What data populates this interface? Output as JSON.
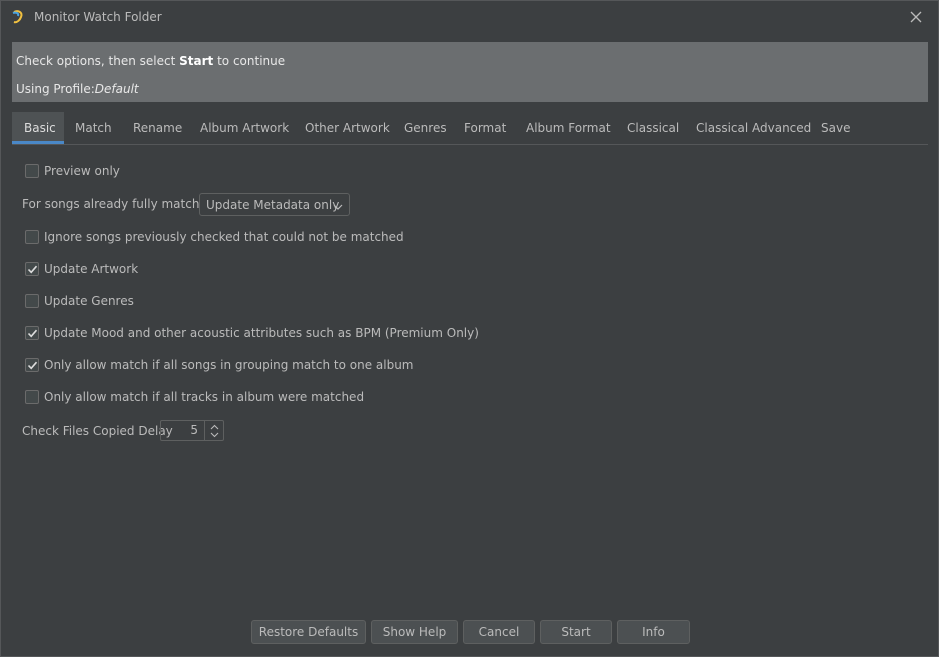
{
  "window": {
    "title": "Monitor Watch Folder"
  },
  "info": {
    "line1_prefix": "Check options, then select ",
    "line1_bold": "Start",
    "line1_suffix": " to continue",
    "profile_label": "Using Profile:",
    "profile_value": "Default"
  },
  "tabs": [
    {
      "label": "Basic",
      "active": true
    },
    {
      "label": "Match"
    },
    {
      "label": "Rename"
    },
    {
      "label": "Album Artwork"
    },
    {
      "label": "Other Artwork"
    },
    {
      "label": "Genres"
    },
    {
      "label": "Format"
    },
    {
      "label": "Album Format"
    },
    {
      "label": "Classical"
    },
    {
      "label": "Classical Advanced"
    },
    {
      "label": "Save"
    }
  ],
  "options": {
    "preview_only": {
      "label": "Preview only",
      "checked": false
    },
    "fully_matched_label": "For songs already fully matched",
    "fully_matched_value": "Update Metadata only",
    "ignore_previous": {
      "label": "Ignore songs previously checked that could not be matched",
      "checked": false
    },
    "update_artwork": {
      "label": "Update Artwork",
      "checked": true
    },
    "update_genres": {
      "label": "Update Genres",
      "checked": false
    },
    "update_mood": {
      "label": "Update Mood and other acoustic attributes such as BPM (Premium Only)",
      "checked": true
    },
    "only_grouping": {
      "label": "Only allow match if all songs in grouping match to one album",
      "checked": true
    },
    "only_all_tracks": {
      "label": "Only allow match if all tracks in album were matched",
      "checked": false
    },
    "delay_label": "Check Files Copied Delay",
    "delay_value": "5"
  },
  "buttons": {
    "restore": "Restore Defaults",
    "help": "Show Help",
    "cancel": "Cancel",
    "start": "Start",
    "info": "Info"
  },
  "colors": {
    "background": "#3c3f41",
    "info_panel": "#6b6e70",
    "tab_accent": "#4a88c7"
  }
}
